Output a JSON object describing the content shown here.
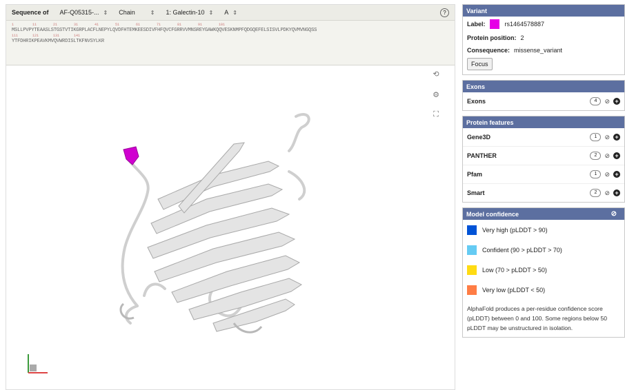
{
  "toolbar": {
    "sequence_of": "Sequence of",
    "model": "AF-Q05315-...",
    "chain_label": "Chain",
    "entity": "1: Galectin-10",
    "chain": "A",
    "help_icon": "?"
  },
  "sequence": {
    "lines": [
      {
        "numbers": "1         11        21        31        41        51        61        71        81        91        101",
        "text": "MSLLPVPYTEAASLSTGSTVTIKGRPLACFLNEPYLQVDFHTEMKEESDIVFHFQVCFGRRVVMNSREYGAWKQQVESKNMPFQDGQEFELSISVLPDKYQVMVNGQSS"
      },
      {
        "numbers": "111       121       131       141",
        "text": "YTFDHRIKPEAVKMVQVWRDISLTKFNVSYLKR"
      }
    ]
  },
  "viewer_controls": {
    "reset": "⟲",
    "settings": "⚙",
    "expand": "⛶"
  },
  "variant": {
    "header": "Variant",
    "label_key": "Label:",
    "label_value": "rs1464578887",
    "label_color": "#e600e6",
    "position_key": "Protein position:",
    "position_value": "2",
    "consequence_key": "Consequence:",
    "consequence_value": "missense_variant",
    "focus_button": "Focus"
  },
  "exons": {
    "header": "Exons",
    "rows": [
      {
        "name": "Exons",
        "count": "4"
      }
    ]
  },
  "protein_features": {
    "header": "Protein features",
    "rows": [
      {
        "name": "Gene3D",
        "count": "1"
      },
      {
        "name": "PANTHER",
        "count": "2"
      },
      {
        "name": "Pfam",
        "count": "1"
      },
      {
        "name": "Smart",
        "count": "2"
      }
    ]
  },
  "model_confidence": {
    "header": "Model confidence",
    "levels": [
      {
        "label": "Very high (pLDDT > 90)",
        "color": "#0053d6"
      },
      {
        "label": "Confident (90 > pLDDT > 70)",
        "color": "#65cbf3"
      },
      {
        "label": "Low (70 > pLDDT > 50)",
        "color": "#ffdb13"
      },
      {
        "label": "Very low (pLDDT < 50)",
        "color": "#ff7d45"
      }
    ],
    "note": "AlphaFold produces a per-residue confidence score (pLDDT) between 0 and 100. Some regions below 50 pLDDT may be unstructured in isolation."
  }
}
